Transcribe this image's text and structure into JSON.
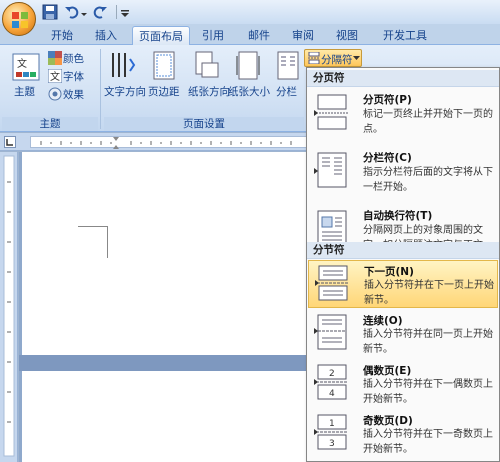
{
  "quick_access": {
    "save_icon": "save-icon",
    "undo_icon": "undo-icon",
    "redo_icon": "redo-icon"
  },
  "tabs": [
    {
      "label": "开始"
    },
    {
      "label": "插入"
    },
    {
      "label": "页面布局",
      "active": true
    },
    {
      "label": "引用"
    },
    {
      "label": "邮件"
    },
    {
      "label": "审阅"
    },
    {
      "label": "视图"
    },
    {
      "label": "开发工具"
    }
  ],
  "ribbon": {
    "theme_group": {
      "label": "主题",
      "theme_button": "主题",
      "colors": "颜色",
      "fonts": "字体",
      "effects": "效果"
    },
    "page_setup_group": {
      "label": "页面设置",
      "text_direction": "文字方向",
      "margins": "页边距",
      "orientation": "纸张方向",
      "size": "纸张大小",
      "columns": "分栏"
    },
    "breaks_button": "分隔符"
  },
  "dropdown": {
    "page_breaks_header": "分页符",
    "section_breaks_header": "分节符",
    "items": [
      {
        "title": "分页符(P)",
        "desc": "标记一页终止并开始下一页的点。"
      },
      {
        "title": "分栏符(C)",
        "desc": "指示分栏符后面的文字将从下一栏开始。"
      },
      {
        "title": "自动换行符(T)",
        "desc": "分隔网页上的对象周围的文字，如分隔题注文字与正文。"
      },
      {
        "title": "下一页(N)",
        "desc": "插入分节符并在下一页上开始新节。"
      },
      {
        "title": "连续(O)",
        "desc": "插入分节符并在同一页上开始新节。"
      },
      {
        "title": "偶数页(E)",
        "desc": "插入分节符并在下一偶数页上开始新节。"
      },
      {
        "title": "奇数页(D)",
        "desc": "插入分节符并在下一奇数页上开始新节。"
      }
    ]
  }
}
